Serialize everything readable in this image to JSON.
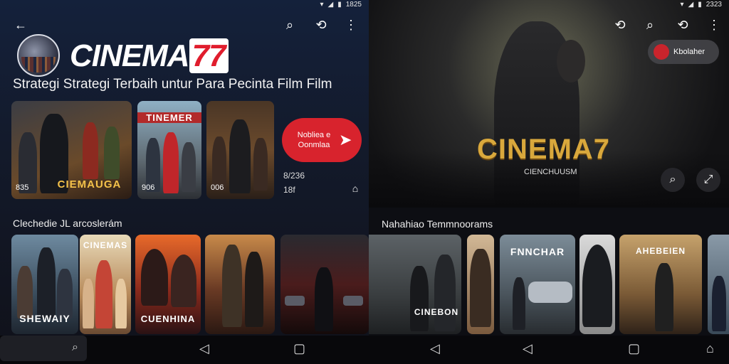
{
  "status": {
    "left_time": "1825",
    "right_time": "2323"
  },
  "left": {
    "brand": {
      "prefix": "CINEMA",
      "num": "77"
    },
    "tagline": "Strategi Strategi Terbaih untur Para Pecinta Film Film",
    "cta": {
      "label": "Nobliea e Oonmlaa",
      "arrow": "➤"
    },
    "side_info": {
      "line1": "8/236",
      "line2": "18f"
    },
    "featured": [
      {
        "title": "CIEMAUGA",
        "meta": "835"
      },
      {
        "title": "TINEMER",
        "meta": "906"
      },
      {
        "title": "",
        "meta": "006"
      }
    ],
    "section_title": "Clechedie JL arcoslerám",
    "row": [
      {
        "title": "SHEWAIY",
        "top": ""
      },
      {
        "title": "",
        "top": "CINEMAS"
      },
      {
        "title": "CUENHINA",
        "top": ""
      },
      {
        "title": "",
        "top": ""
      },
      {
        "title": "",
        "top": ""
      }
    ]
  },
  "right": {
    "chip_label": "Kbolaher",
    "hero_title": "CINEMA7",
    "hero_sub": "CIENCHUUSM",
    "section_title": "Nahahiao Temmnoorams",
    "row": [
      {
        "title": "CINEBON"
      },
      {
        "title": ""
      },
      {
        "title": "FNNCHAR"
      },
      {
        "title": ""
      },
      {
        "title": "AHEBEIEN"
      },
      {
        "title": ""
      }
    ]
  },
  "icons": {
    "back": "←",
    "search": "⌕",
    "share": "⟲",
    "more": "⋮",
    "nav_back": "◁",
    "nav_home": "▢",
    "nav_extra": "⌂"
  }
}
